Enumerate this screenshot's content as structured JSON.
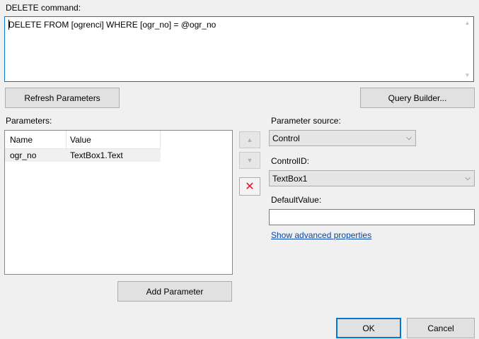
{
  "command": {
    "label": "DELETE command:",
    "text": "DELETE FROM [ogrenci] WHERE [ogr_no] = @ogr_no"
  },
  "buttons": {
    "refresh": "Refresh Parameters",
    "query_builder": "Query Builder...",
    "add_parameter": "Add Parameter",
    "ok": "OK",
    "cancel": "Cancel"
  },
  "parameters": {
    "label": "Parameters:",
    "columns": [
      "Name",
      "Value"
    ],
    "rows": [
      {
        "name": "ogr_no",
        "value": "TextBox1.Text"
      }
    ]
  },
  "side_icons": {
    "up": "arrow-up-icon",
    "down": "arrow-down-icon",
    "delete": "delete-x-icon"
  },
  "right": {
    "source_label": "Parameter source:",
    "source_value": "Control",
    "controlid_label": "ControlID:",
    "controlid_value": "TextBox1",
    "default_label": "DefaultValue:",
    "default_value": "",
    "advanced_link": "Show advanced properties"
  },
  "colors": {
    "accent": "#0078d7",
    "link": "#0645ad",
    "delete_red": "#e81123",
    "background": "#f0f0f0"
  }
}
